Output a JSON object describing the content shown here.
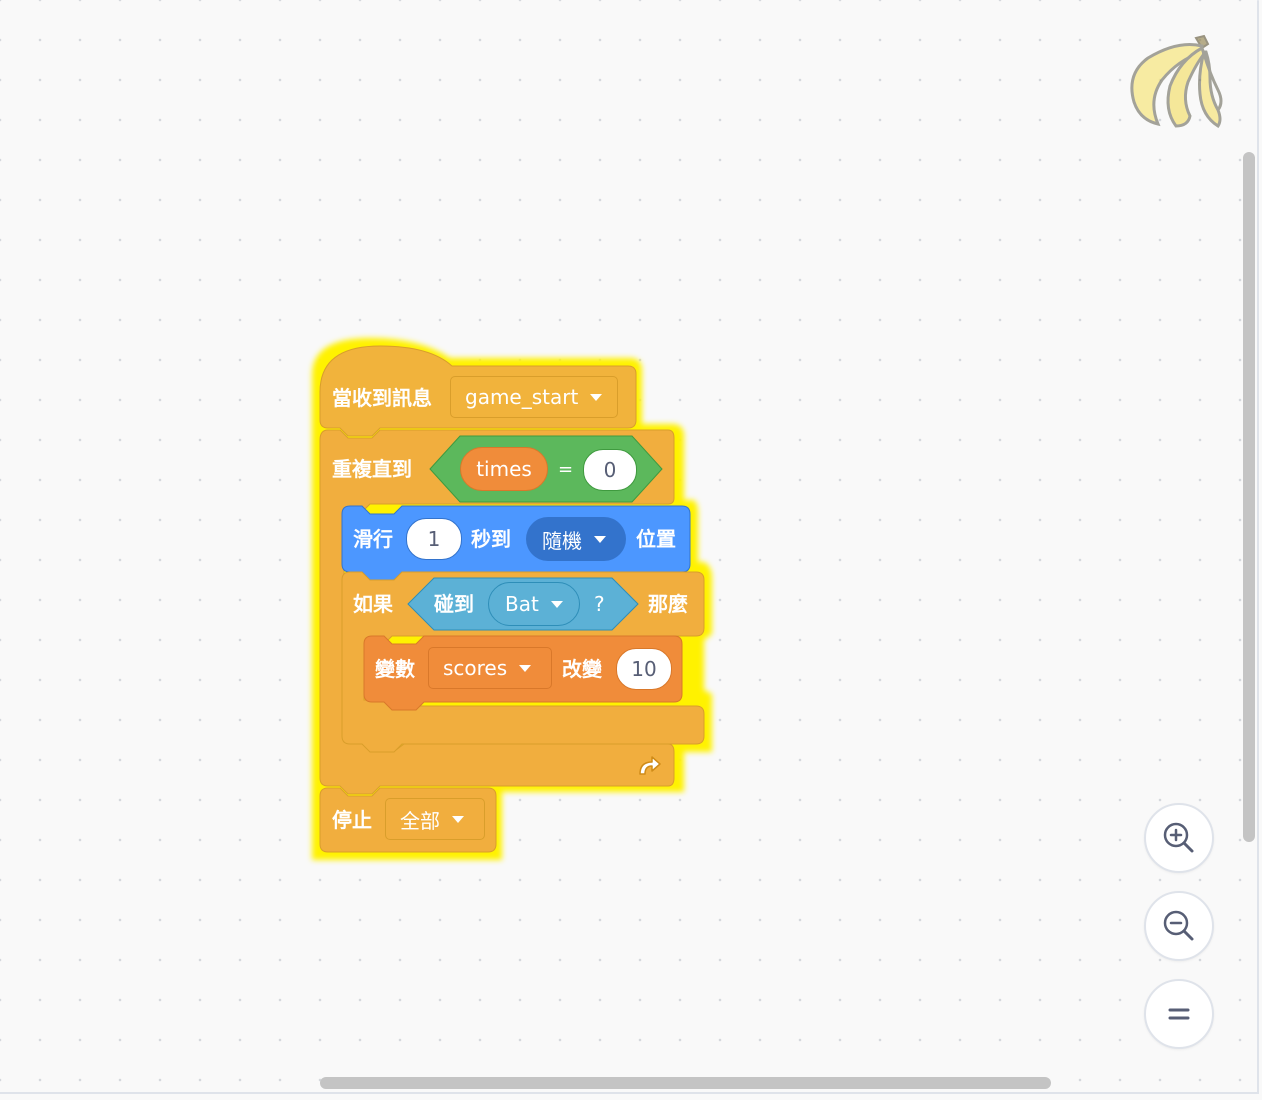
{
  "colors": {
    "events": "#ffbf00",
    "control": "#ffab19",
    "control_dark": "#cf8b17",
    "motion": "#4c97ff",
    "motion_dark": "#3373cc",
    "operators": "#59c059",
    "sensing": "#5cb1d6",
    "sensing_dark": "#2e8eb8",
    "variables": "#ff8c1a",
    "glow": "#fff200"
  },
  "hat_block": {
    "label": "當收到訊息",
    "message": "game_start"
  },
  "repeat_block": {
    "label": "重複直到",
    "condition_var": "times",
    "operator": "=",
    "compare_value": "0",
    "loop_icon": "loop-arrow-icon"
  },
  "glide_block": {
    "label_pre": "滑行",
    "seconds": "1",
    "label_mid": "秒到",
    "target": "隨機",
    "label_post": "位置"
  },
  "if_block": {
    "label_if": "如果",
    "sensing_label": "碰到",
    "sensing_target": "Bat",
    "question": "?",
    "label_then": "那麼"
  },
  "change_var_block": {
    "label": "變數",
    "variable": "scores",
    "label_change": "改變",
    "amount": "10"
  },
  "stop_block": {
    "label": "停止",
    "option": "全部"
  },
  "sprite": {
    "icon": "banana-icon"
  },
  "zoom_controls": {
    "zoom_in_icon": "zoom-in-icon",
    "zoom_out_icon": "zoom-out-icon",
    "reset_icon": "zoom-reset-icon"
  }
}
